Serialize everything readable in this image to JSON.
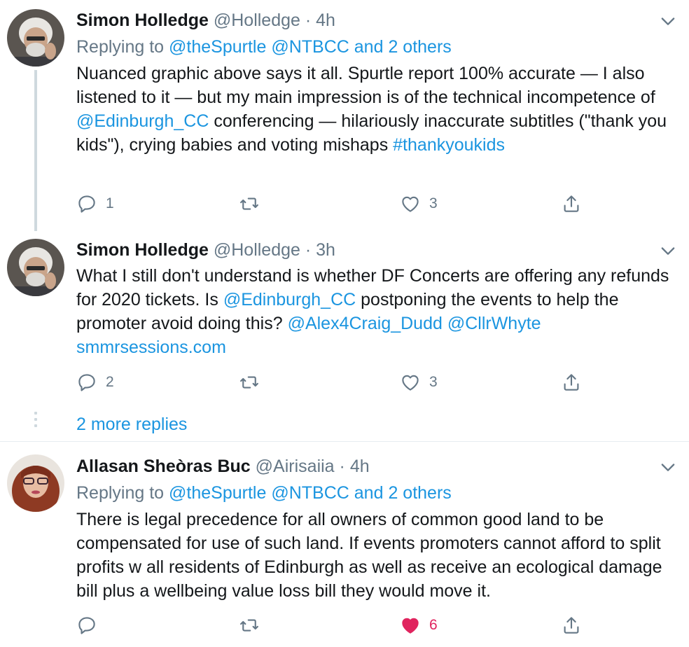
{
  "tweets": [
    {
      "name": "Simon Holledge",
      "handle": "@Holledge",
      "sep": "·",
      "time": "4h",
      "replying_label": "Replying to",
      "replying_to": [
        "@theSpurtle",
        "@NTBCC",
        "and 2 others"
      ],
      "body": [
        {
          "t": "Nuanced graphic above says it all. Spurtle report 100% accurate — I also listened to it — but my main impression is of the technical incompetence of "
        },
        {
          "t": "@Edinburgh_CC",
          "link": true
        },
        {
          "t": " conferencing — hilariously inaccurate subtitles (\"thank you kids\"), crying babies and voting mishaps "
        },
        {
          "t": "#thankyoukids",
          "link": true
        }
      ],
      "reply_count": "1",
      "retweet_count": "",
      "like_count": "3",
      "liked": false
    },
    {
      "name": "Simon Holledge",
      "handle": "@Holledge",
      "sep": "·",
      "time": "3h",
      "body": [
        {
          "t": "What I still don't understand is whether DF Concerts are offering any refunds for 2020 tickets. Is "
        },
        {
          "t": "@Edinburgh_CC",
          "link": true
        },
        {
          "t": " postponing the events to help the promoter avoid doing this? "
        },
        {
          "t": "@Alex4Craig_Dudd",
          "link": true
        },
        {
          "t": " "
        },
        {
          "t": "@CllrWhyte",
          "link": true
        },
        {
          "t": " "
        },
        {
          "t": "smmrsessions.com",
          "link": true
        }
      ],
      "reply_count": "2",
      "retweet_count": "",
      "like_count": "3",
      "liked": false
    },
    {
      "name": "Allasan Sheòras Buc",
      "handle": "@Airisaiia",
      "sep": "·",
      "time": "4h",
      "replying_label": "Replying to",
      "replying_to": [
        "@theSpurtle",
        "@NTBCC",
        "and 2 others"
      ],
      "body": [
        {
          "t": "There is legal precedence for all owners of common good land to be compensated for use of such land. If events promoters cannot afford to split profits w all residents of Edinburgh as well as receive an ecological damage bill plus a wellbeing value loss bill they would move it."
        }
      ],
      "reply_count": "",
      "retweet_count": "",
      "like_count": "6",
      "liked": true
    }
  ],
  "more_replies": "2 more replies",
  "icons": {
    "reply": "reply-icon",
    "retweet": "retweet-icon",
    "like": "heart-icon",
    "share": "share-icon",
    "menu": "chevron-down-icon"
  },
  "colors": {
    "link": "#1b95e0",
    "muted": "#657786",
    "like_active": "#e0245e",
    "thread_line": "#cfd9de"
  }
}
